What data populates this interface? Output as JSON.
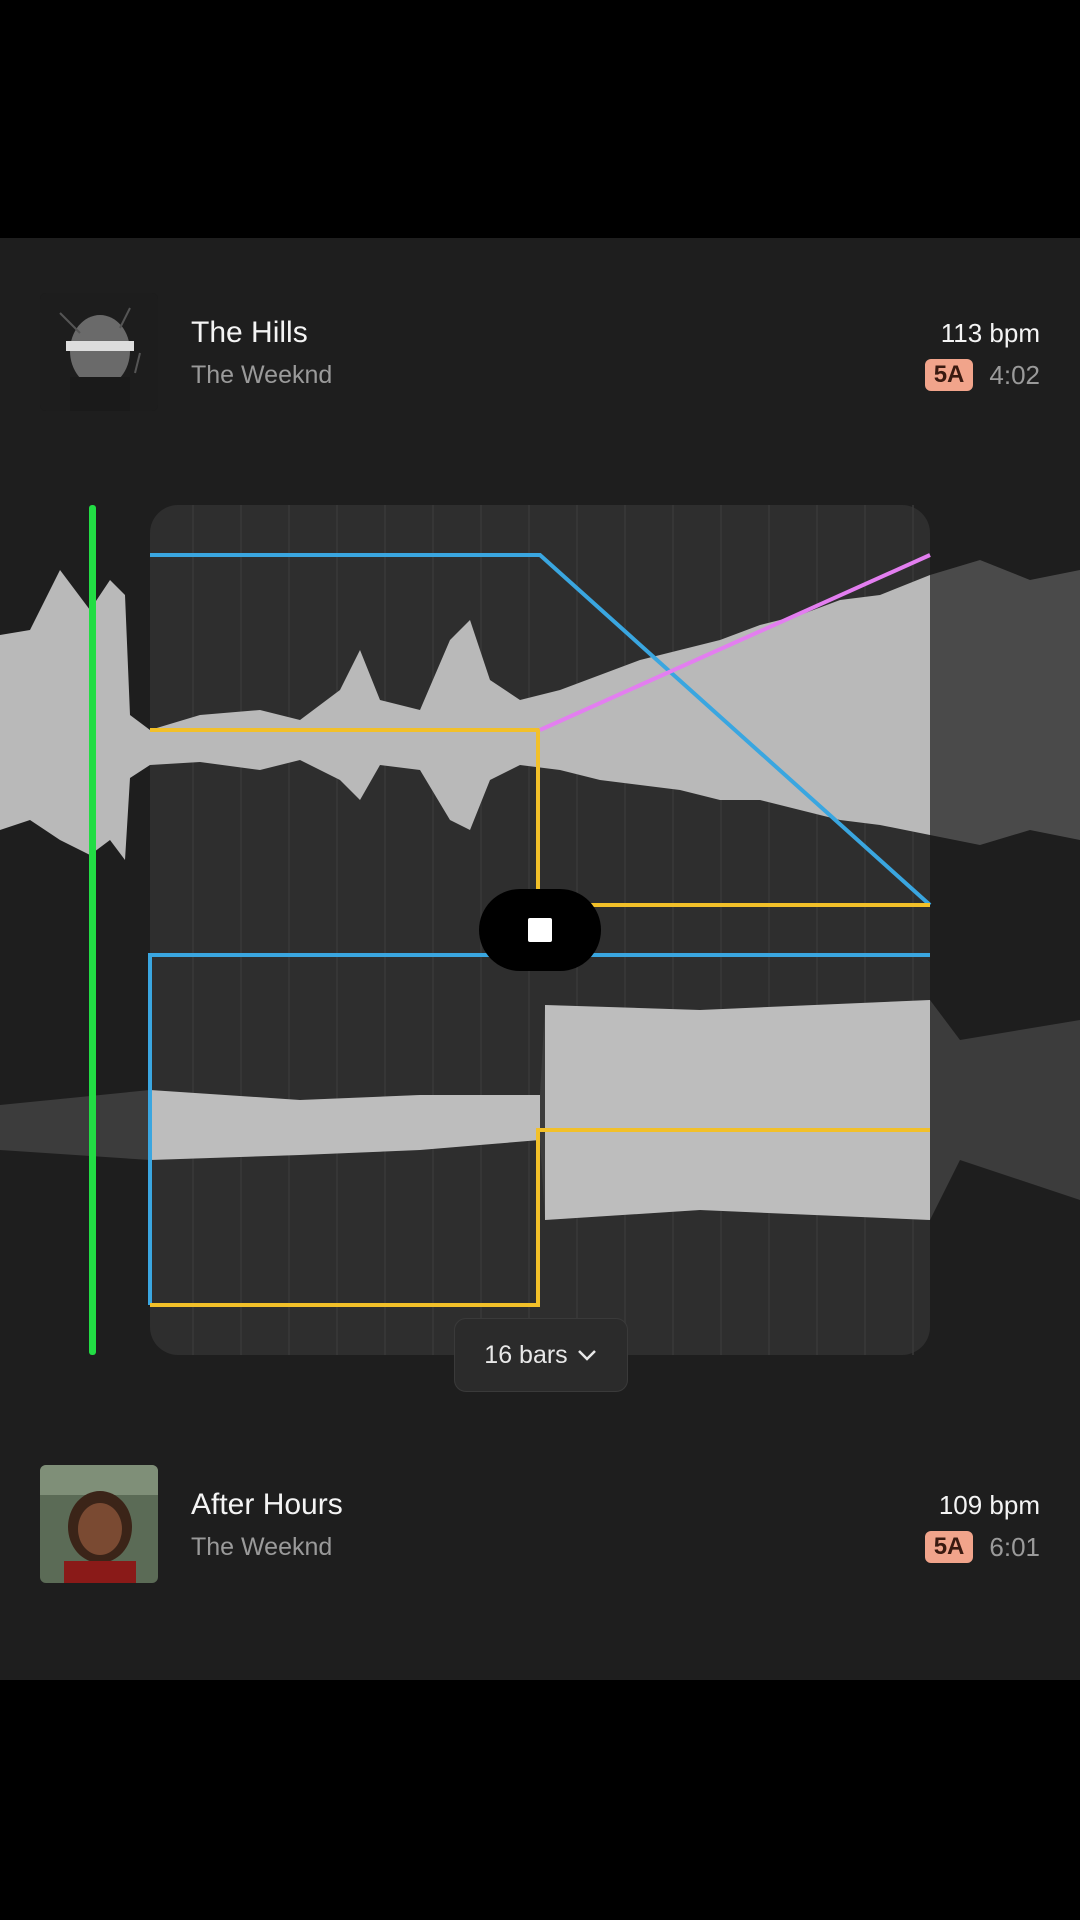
{
  "track_top": {
    "title": "The Hills",
    "artist": "The Weeknd",
    "bpm": "113 bpm",
    "key": "5A",
    "duration": "4:02",
    "key_color": "#f1a48b"
  },
  "track_bottom": {
    "title": "After Hours",
    "artist": "The Weeknd",
    "bpm": "109 bpm",
    "key": "5A",
    "duration": "6:01",
    "key_color": "#f1a48b"
  },
  "transition": {
    "length_label": "16 bars",
    "playhead_color": "#22dd44",
    "automation_colors": {
      "volume": "#3aa6e0",
      "eq": "#f2c029",
      "effect": "#e37ef0"
    }
  },
  "icons": {
    "stop": "stop-icon",
    "dropdown": "chevron-down-icon"
  }
}
